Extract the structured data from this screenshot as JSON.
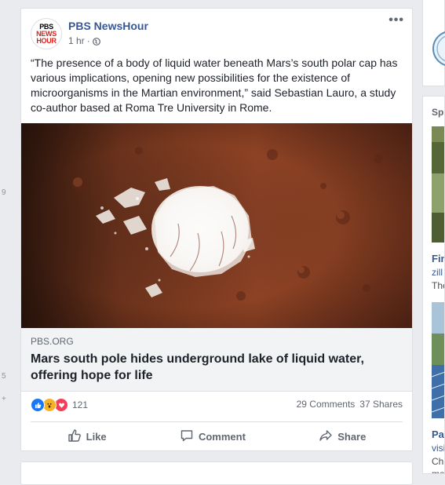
{
  "left_gutter": {
    "numbers": [
      "9",
      "5",
      "+"
    ]
  },
  "post": {
    "avatar": {
      "line1": "PBS",
      "line2": "NEWS",
      "line3": "HOUR"
    },
    "page_name": "PBS NewsHour",
    "time": "1 hr",
    "separator": "·",
    "privacy_icon": "globe-icon",
    "more_label": "•••",
    "text": "“The presence of a body of liquid water beneath Mars’s south polar cap has various implications, opening new possibilities for the existence of microorganisms in the Martian environment,” said Sebastian Lauro, a study co-author based at Roma Tre University in Rome.",
    "link": {
      "domain": "PBS.ORG",
      "headline": "Mars south pole hides underground lake of liquid water, offering hope for life"
    },
    "reactions": {
      "icons": [
        "like-icon",
        "wow-icon",
        "love-icon"
      ],
      "count": "121"
    },
    "comments": "29 Comments",
    "shares": "37 Shares",
    "actions": {
      "like": "Like",
      "comment": "Comment",
      "share": "Share"
    }
  },
  "sidebar": {
    "sponsored": "Sp",
    "ads": [
      {
        "title": "Fin",
        "line1": "zill",
        "line2": "The"
      },
      {
        "title": "Pa",
        "line1": "visi",
        "line2": "Ch",
        "line3": "me"
      }
    ]
  },
  "colors": {
    "brand_link": "#365899",
    "page_bg": "#e9ebee",
    "mars": "#8b3a1e"
  }
}
